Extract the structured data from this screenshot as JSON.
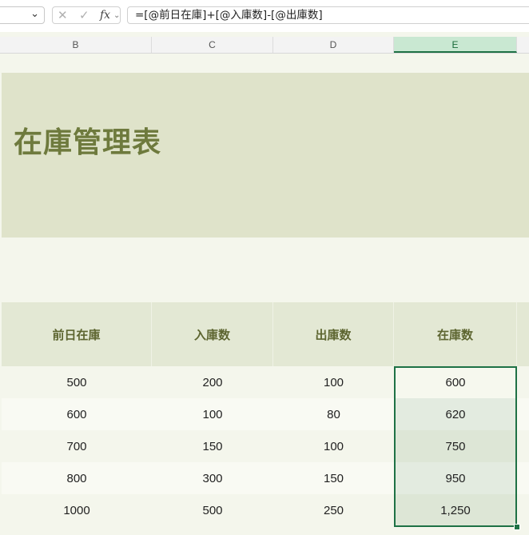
{
  "formula_bar": {
    "name_box_chevron": "⌄",
    "cancel_icon": "✕",
    "enter_icon": "✓",
    "fx_label": "fx",
    "fx_chevron": "⌄",
    "formula": "=[@前日在庫]+[@入庫数]-[@出庫数]"
  },
  "columns": [
    "B",
    "C",
    "D",
    "E"
  ],
  "selected_column": "E",
  "sheet": {
    "title": "在庫管理表",
    "headers": [
      "前日在庫",
      "入庫数",
      "出庫数",
      "在庫数"
    ],
    "rows": [
      [
        "500",
        "200",
        "100",
        "600"
      ],
      [
        "600",
        "100",
        "80",
        "620"
      ],
      [
        "700",
        "150",
        "100",
        "750"
      ],
      [
        "800",
        "300",
        "150",
        "950"
      ],
      [
        "1000",
        "500",
        "250",
        "1,250"
      ]
    ]
  },
  "colors": {
    "title_band": "#dfe3ca",
    "title_text": "#6e7a3d",
    "header_fill": "#e3e8d4",
    "row_odd": "#f4f6ec",
    "row_even": "#f9faf3",
    "selection": "#1e7145",
    "selected_cell_fill": "#e2ebdf"
  }
}
